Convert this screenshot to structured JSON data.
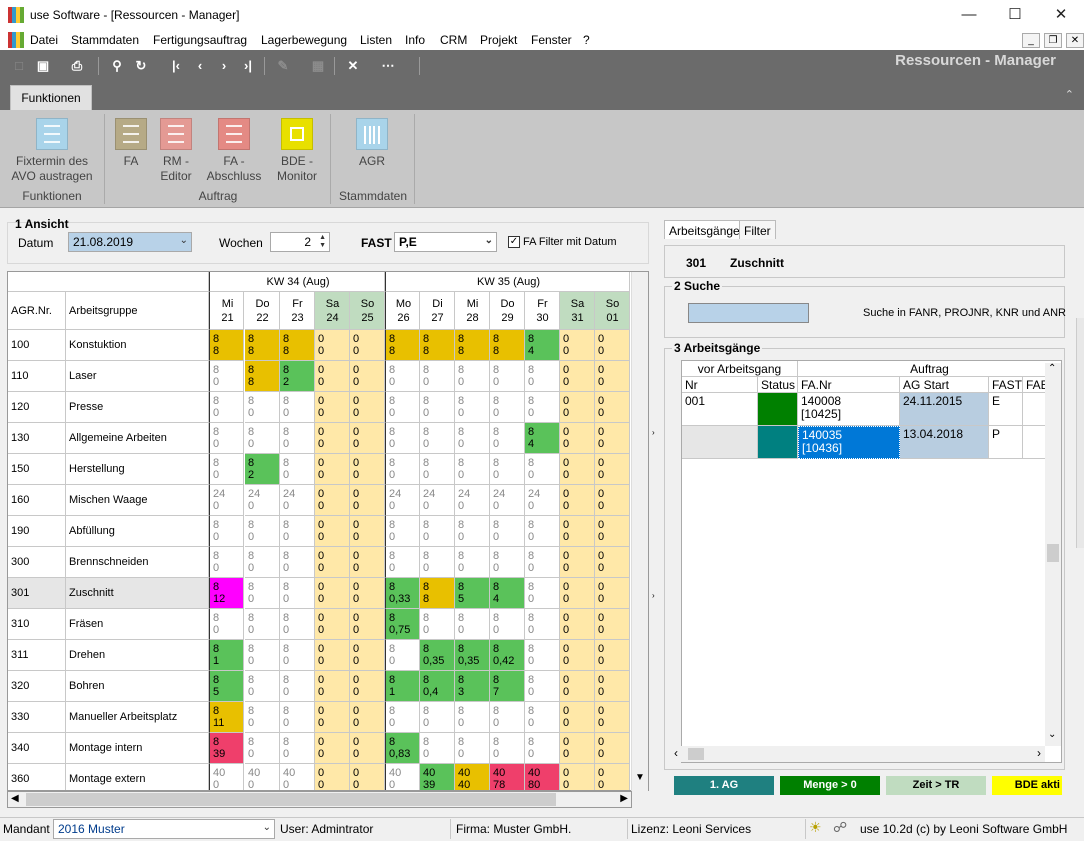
{
  "window": {
    "title": "use Software - [Ressourcen - Manager]"
  },
  "menu": [
    "Datei",
    "Stammdaten",
    "Fertigungsauftrag",
    "Lagerbewegung",
    "Listen",
    "Info",
    "CRM",
    "Projekt",
    "Fenster",
    "?"
  ],
  "toolbar": {
    "module_title": "Ressourcen - Manager"
  },
  "ribbon": {
    "tab": "Funktionen",
    "buttons": [
      {
        "label": "Fixtermin des\nAVO austragen",
        "color": "#a9d4ea"
      },
      {
        "label": "FA",
        "color": "#b6aa86"
      },
      {
        "label": "RM -\nEditor",
        "color": "#e49a94"
      },
      {
        "label": "FA -\nAbschluss",
        "color": "#e48a84"
      },
      {
        "label": "BDE -\nMonitor",
        "color": "#e8e000"
      },
      {
        "label": "AGR",
        "color": "#a9d4ea"
      }
    ],
    "groups": [
      "Funktionen",
      "Auftrag",
      "Stammdaten"
    ]
  },
  "ansicht": {
    "title": "1 Ansicht",
    "datum_label": "Datum",
    "datum_value": "21.08.2019",
    "wochen_label": "Wochen",
    "wochen_value": "2",
    "fast_label": "FAST",
    "fast_value": "P,E",
    "fa_filter_label": "FA Filter mit Datum",
    "fa_filter_checked": true
  },
  "grid": {
    "weeks": [
      "KW 34 (Aug)",
      "KW 35 (Aug)"
    ],
    "col_agr": "AGR.Nr.",
    "col_group": "Arbeitsgruppe",
    "days": [
      {
        "d": "Mi",
        "n": "21",
        "we": false
      },
      {
        "d": "Do",
        "n": "22",
        "we": false
      },
      {
        "d": "Fr",
        "n": "23",
        "we": false
      },
      {
        "d": "Sa",
        "n": "24",
        "we": true
      },
      {
        "d": "So",
        "n": "25",
        "we": true
      },
      {
        "d": "Mo",
        "n": "26",
        "we": false
      },
      {
        "d": "Di",
        "n": "27",
        "we": false
      },
      {
        "d": "Mi",
        "n": "28",
        "we": false
      },
      {
        "d": "Do",
        "n": "29",
        "we": false
      },
      {
        "d": "Fr",
        "n": "30",
        "we": false
      },
      {
        "d": "Sa",
        "n": "31",
        "we": true
      },
      {
        "d": "So",
        "n": "01",
        "we": true
      }
    ],
    "rows": [
      {
        "nr": "100",
        "name": "Konstuktion",
        "cells": [
          [
            "8",
            "8",
            "y"
          ],
          [
            "8",
            "8",
            "y"
          ],
          [
            "8",
            "8",
            "y"
          ],
          [
            "0",
            "0",
            "w"
          ],
          [
            "0",
            "0",
            "w"
          ],
          [
            "8",
            "8",
            "y"
          ],
          [
            "8",
            "8",
            "y"
          ],
          [
            "8",
            "8",
            "y"
          ],
          [
            "8",
            "8",
            "y"
          ],
          [
            "8",
            "4",
            "g"
          ],
          [
            "0",
            "0",
            "w"
          ],
          [
            "0",
            "0",
            "w"
          ]
        ]
      },
      {
        "nr": "110",
        "name": "Laser",
        "cells": [
          [
            "8",
            "0",
            "n"
          ],
          [
            "8",
            "8",
            "y"
          ],
          [
            "8",
            "2",
            "g"
          ],
          [
            "0",
            "0",
            "w"
          ],
          [
            "0",
            "0",
            "w"
          ],
          [
            "8",
            "0",
            "n"
          ],
          [
            "8",
            "0",
            "n"
          ],
          [
            "8",
            "0",
            "n"
          ],
          [
            "8",
            "0",
            "n"
          ],
          [
            "8",
            "0",
            "n"
          ],
          [
            "0",
            "0",
            "w"
          ],
          [
            "0",
            "0",
            "w"
          ]
        ]
      },
      {
        "nr": "120",
        "name": "Presse",
        "cells": [
          [
            "8",
            "0",
            "n"
          ],
          [
            "8",
            "0",
            "n"
          ],
          [
            "8",
            "0",
            "n"
          ],
          [
            "0",
            "0",
            "w"
          ],
          [
            "0",
            "0",
            "w"
          ],
          [
            "8",
            "0",
            "n"
          ],
          [
            "8",
            "0",
            "n"
          ],
          [
            "8",
            "0",
            "n"
          ],
          [
            "8",
            "0",
            "n"
          ],
          [
            "8",
            "0",
            "n"
          ],
          [
            "0",
            "0",
            "w"
          ],
          [
            "0",
            "0",
            "w"
          ]
        ]
      },
      {
        "nr": "130",
        "name": "Allgemeine Arbeiten",
        "cells": [
          [
            "8",
            "0",
            "n"
          ],
          [
            "8",
            "0",
            "n"
          ],
          [
            "8",
            "0",
            "n"
          ],
          [
            "0",
            "0",
            "w"
          ],
          [
            "0",
            "0",
            "w"
          ],
          [
            "8",
            "0",
            "n"
          ],
          [
            "8",
            "0",
            "n"
          ],
          [
            "8",
            "0",
            "n"
          ],
          [
            "8",
            "0",
            "n"
          ],
          [
            "8",
            "4",
            "g"
          ],
          [
            "0",
            "0",
            "w"
          ],
          [
            "0",
            "0",
            "w"
          ]
        ]
      },
      {
        "nr": "150",
        "name": "Herstellung",
        "cells": [
          [
            "8",
            "0",
            "n"
          ],
          [
            "8",
            "2",
            "g"
          ],
          [
            "8",
            "0",
            "n"
          ],
          [
            "0",
            "0",
            "w"
          ],
          [
            "0",
            "0",
            "w"
          ],
          [
            "8",
            "0",
            "n"
          ],
          [
            "8",
            "0",
            "n"
          ],
          [
            "8",
            "0",
            "n"
          ],
          [
            "8",
            "0",
            "n"
          ],
          [
            "8",
            "0",
            "n"
          ],
          [
            "0",
            "0",
            "w"
          ],
          [
            "0",
            "0",
            "w"
          ]
        ]
      },
      {
        "nr": "160",
        "name": "Mischen Waage",
        "cells": [
          [
            "24",
            "0",
            "n"
          ],
          [
            "24",
            "0",
            "n"
          ],
          [
            "24",
            "0",
            "n"
          ],
          [
            "0",
            "0",
            "w"
          ],
          [
            "0",
            "0",
            "w"
          ],
          [
            "24",
            "0",
            "n"
          ],
          [
            "24",
            "0",
            "n"
          ],
          [
            "24",
            "0",
            "n"
          ],
          [
            "24",
            "0",
            "n"
          ],
          [
            "24",
            "0",
            "n"
          ],
          [
            "0",
            "0",
            "w"
          ],
          [
            "0",
            "0",
            "w"
          ]
        ]
      },
      {
        "nr": "190",
        "name": "Abfüllung",
        "cells": [
          [
            "8",
            "0",
            "n"
          ],
          [
            "8",
            "0",
            "n"
          ],
          [
            "8",
            "0",
            "n"
          ],
          [
            "0",
            "0",
            "w"
          ],
          [
            "0",
            "0",
            "w"
          ],
          [
            "8",
            "0",
            "n"
          ],
          [
            "8",
            "0",
            "n"
          ],
          [
            "8",
            "0",
            "n"
          ],
          [
            "8",
            "0",
            "n"
          ],
          [
            "8",
            "0",
            "n"
          ],
          [
            "0",
            "0",
            "w"
          ],
          [
            "0",
            "0",
            "w"
          ]
        ]
      },
      {
        "nr": "300",
        "name": "Brennschneiden",
        "cells": [
          [
            "8",
            "0",
            "n"
          ],
          [
            "8",
            "0",
            "n"
          ],
          [
            "8",
            "0",
            "n"
          ],
          [
            "0",
            "0",
            "w"
          ],
          [
            "0",
            "0",
            "w"
          ],
          [
            "8",
            "0",
            "n"
          ],
          [
            "8",
            "0",
            "n"
          ],
          [
            "8",
            "0",
            "n"
          ],
          [
            "8",
            "0",
            "n"
          ],
          [
            "8",
            "0",
            "n"
          ],
          [
            "0",
            "0",
            "w"
          ],
          [
            "0",
            "0",
            "w"
          ]
        ]
      },
      {
        "nr": "301",
        "name": "Zuschnitt",
        "sel": true,
        "cells": [
          [
            "8",
            "12",
            "m"
          ],
          [
            "8",
            "0",
            "n"
          ],
          [
            "8",
            "0",
            "n"
          ],
          [
            "0",
            "0",
            "w"
          ],
          [
            "0",
            "0",
            "w"
          ],
          [
            "8",
            "0,33",
            "g"
          ],
          [
            "8",
            "8",
            "y"
          ],
          [
            "8",
            "5",
            "g"
          ],
          [
            "8",
            "4",
            "g"
          ],
          [
            "8",
            "0",
            "n"
          ],
          [
            "0",
            "0",
            "w"
          ],
          [
            "0",
            "0",
            "w"
          ]
        ]
      },
      {
        "nr": "310",
        "name": "Fräsen",
        "cells": [
          [
            "8",
            "0",
            "n"
          ],
          [
            "8",
            "0",
            "n"
          ],
          [
            "8",
            "0",
            "n"
          ],
          [
            "0",
            "0",
            "w"
          ],
          [
            "0",
            "0",
            "w"
          ],
          [
            "8",
            "0,75",
            "g"
          ],
          [
            "8",
            "0",
            "n"
          ],
          [
            "8",
            "0",
            "n"
          ],
          [
            "8",
            "0",
            "n"
          ],
          [
            "8",
            "0",
            "n"
          ],
          [
            "0",
            "0",
            "w"
          ],
          [
            "0",
            "0",
            "w"
          ]
        ]
      },
      {
        "nr": "311",
        "name": "Drehen",
        "cells": [
          [
            "8",
            "1",
            "g"
          ],
          [
            "8",
            "0",
            "n"
          ],
          [
            "8",
            "0",
            "n"
          ],
          [
            "0",
            "0",
            "w"
          ],
          [
            "0",
            "0",
            "w"
          ],
          [
            "8",
            "0",
            "n"
          ],
          [
            "8",
            "0,35",
            "g"
          ],
          [
            "8",
            "0,35",
            "g"
          ],
          [
            "8",
            "0,42",
            "g"
          ],
          [
            "8",
            "0",
            "n"
          ],
          [
            "0",
            "0",
            "w"
          ],
          [
            "0",
            "0",
            "w"
          ]
        ]
      },
      {
        "nr": "320",
        "name": "Bohren",
        "cells": [
          [
            "8",
            "5",
            "g"
          ],
          [
            "8",
            "0",
            "n"
          ],
          [
            "8",
            "0",
            "n"
          ],
          [
            "0",
            "0",
            "w"
          ],
          [
            "0",
            "0",
            "w"
          ],
          [
            "8",
            "1",
            "g"
          ],
          [
            "8",
            "0,4",
            "g"
          ],
          [
            "8",
            "3",
            "g"
          ],
          [
            "8",
            "7",
            "g"
          ],
          [
            "8",
            "0",
            "n"
          ],
          [
            "0",
            "0",
            "w"
          ],
          [
            "0",
            "0",
            "w"
          ]
        ]
      },
      {
        "nr": "330",
        "name": "Manueller Arbeitsplatz",
        "cells": [
          [
            "8",
            "11",
            "y"
          ],
          [
            "8",
            "0",
            "n"
          ],
          [
            "8",
            "0",
            "n"
          ],
          [
            "0",
            "0",
            "w"
          ],
          [
            "0",
            "0",
            "w"
          ],
          [
            "8",
            "0",
            "n"
          ],
          [
            "8",
            "0",
            "n"
          ],
          [
            "8",
            "0",
            "n"
          ],
          [
            "8",
            "0",
            "n"
          ],
          [
            "8",
            "0",
            "n"
          ],
          [
            "0",
            "0",
            "w"
          ],
          [
            "0",
            "0",
            "w"
          ]
        ]
      },
      {
        "nr": "340",
        "name": "Montage intern",
        "cells": [
          [
            "8",
            "39",
            "r"
          ],
          [
            "8",
            "0",
            "n"
          ],
          [
            "8",
            "0",
            "n"
          ],
          [
            "0",
            "0",
            "w"
          ],
          [
            "0",
            "0",
            "w"
          ],
          [
            "8",
            "0,83",
            "g"
          ],
          [
            "8",
            "0",
            "n"
          ],
          [
            "8",
            "0",
            "n"
          ],
          [
            "8",
            "0",
            "n"
          ],
          [
            "8",
            "0",
            "n"
          ],
          [
            "0",
            "0",
            "w"
          ],
          [
            "0",
            "0",
            "w"
          ]
        ]
      },
      {
        "nr": "360",
        "name": "Montage extern",
        "cells": [
          [
            "40",
            "0",
            "n"
          ],
          [
            "40",
            "0",
            "n"
          ],
          [
            "40",
            "0",
            "n"
          ],
          [
            "0",
            "0",
            "w"
          ],
          [
            "0",
            "0",
            "w"
          ],
          [
            "40",
            "0",
            "n"
          ],
          [
            "40",
            "39",
            "g"
          ],
          [
            "40",
            "40",
            "y"
          ],
          [
            "40",
            "78",
            "r"
          ],
          [
            "40",
            "80",
            "r"
          ],
          [
            "0",
            "0",
            "w"
          ],
          [
            "0",
            "0",
            "w"
          ]
        ]
      }
    ]
  },
  "right": {
    "tabs": [
      "Arbeitsgänge",
      "Filter"
    ],
    "header_nr": "301",
    "header_name": "Zuschnitt",
    "suche_title": "2 Suche",
    "suche_hint": "Suche in FANR, PROJNR, KNR und ANR",
    "ag_title": "3 Arbeitsgänge",
    "ag_group1": "vor Arbeitsgang",
    "ag_group2": "Auftrag",
    "ag_cols": [
      "Nr",
      "Status",
      "FA.Nr",
      "AG Start",
      "FAST",
      "FAE"
    ],
    "ag_rows": [
      {
        "nr": "001",
        "status_color": "#008000",
        "fanr": "140008",
        "fanr2": "[10425]",
        "start": "24.11.2015",
        "fast": "E"
      },
      {
        "nr": "",
        "status_color": "#008080",
        "fanr": "140035",
        "fanr2": "[10436]",
        "start": "13.04.2018",
        "fast": "P"
      }
    ],
    "legend": [
      {
        "label": "1. AG",
        "bg": "#1f8080",
        "fg": "#ffffff"
      },
      {
        "label": "Menge > 0",
        "bg": "#008000",
        "fg": "#ffffff"
      },
      {
        "label": "Zeit > TR",
        "bg": "#c0dcc0",
        "fg": "#000000"
      },
      {
        "label": "BDE akti",
        "bg": "#ffff00",
        "fg": "#000000"
      }
    ]
  },
  "status": {
    "mandant_label": "Mandant",
    "mandant_value": "2016 Muster",
    "user": "User: Admintrator",
    "firma": "Firma: Muster GmbH.",
    "lizenz": "Lizenz: Leoni Services",
    "version": "use 10.2d (c) by Leoni Software GmbH"
  },
  "colors": {
    "yellow": "#e8c000",
    "green": "#5ac25a",
    "magenta": "#ff00ff",
    "red": "#ef3f6b",
    "weekend": "#ffe8a8",
    "weekday": "#ffffff",
    "selection": "#0078d7"
  }
}
